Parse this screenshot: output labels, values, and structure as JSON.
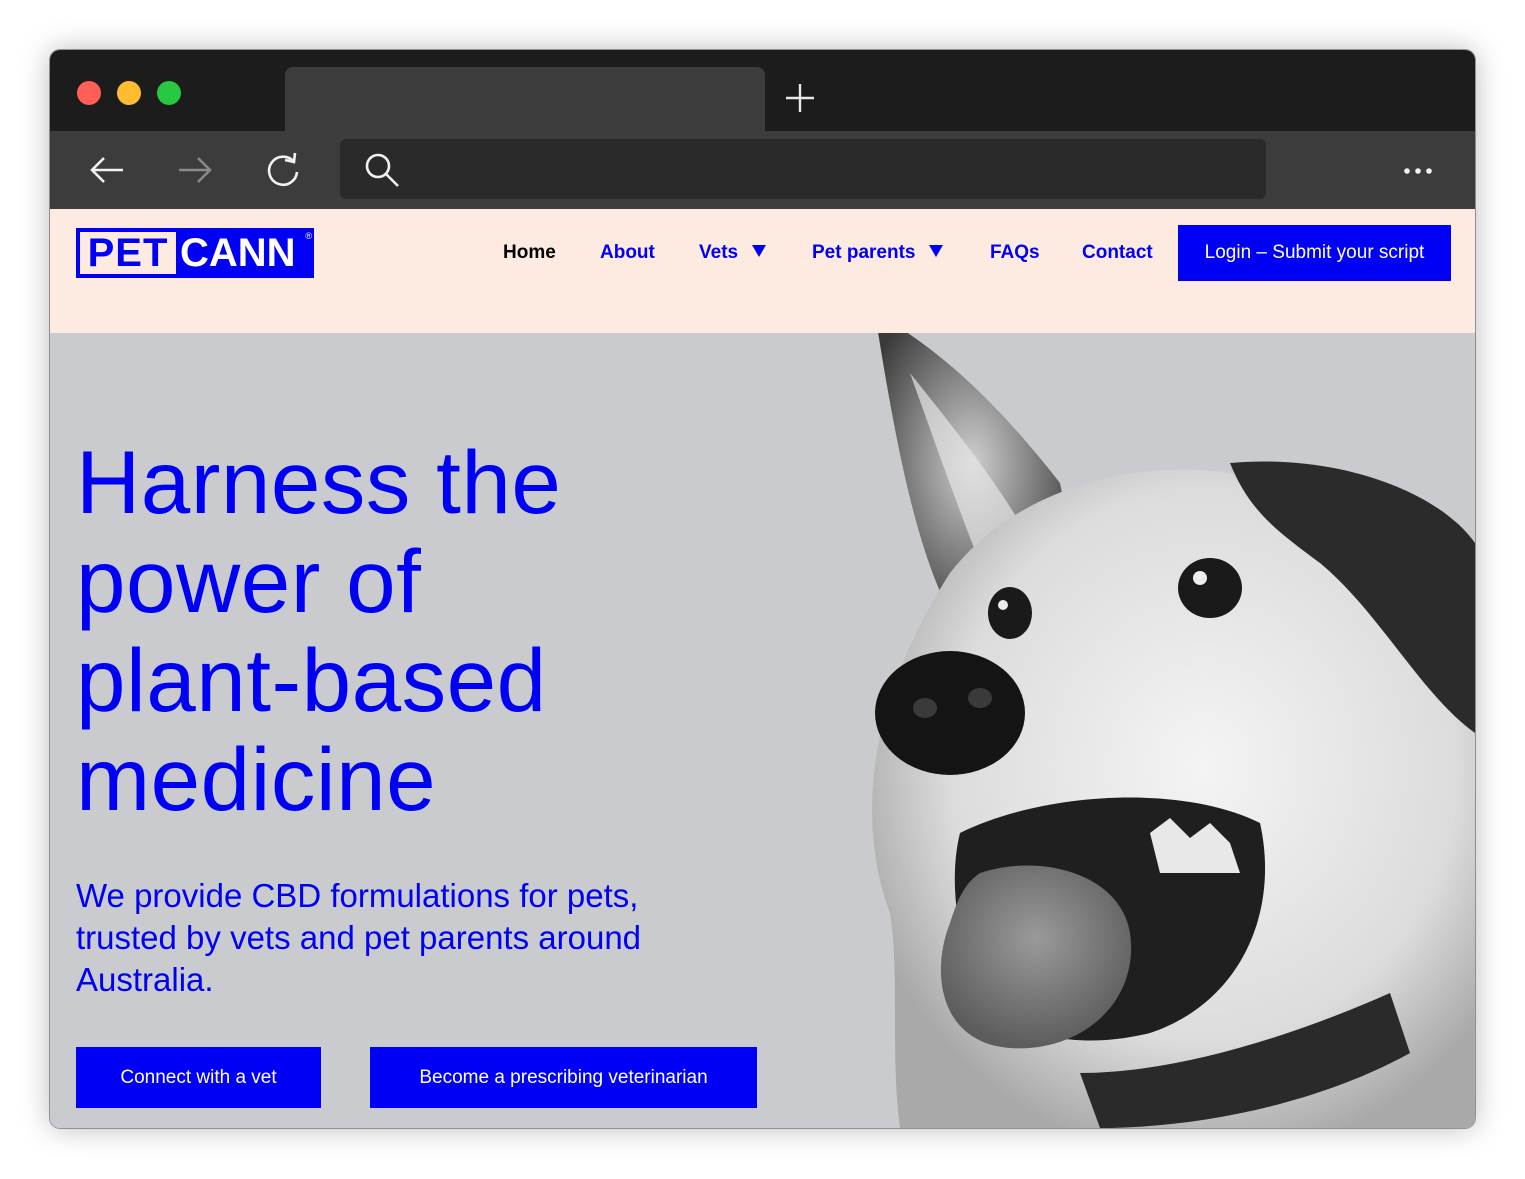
{
  "browser": {
    "traffic_lights": {
      "close": "#ff5f57",
      "minimize": "#febc2e",
      "maximize": "#28c840"
    },
    "tab": {
      "title": ""
    },
    "address_bar": {
      "value": "",
      "placeholder": ""
    },
    "icons": [
      "back-arrow-icon",
      "forward-arrow-icon",
      "reload-icon",
      "search-icon",
      "plus-icon",
      "more-dots-icon"
    ]
  },
  "site": {
    "logo": {
      "part1": "PET",
      "part2": "CANN",
      "registered": "®"
    },
    "nav": {
      "home": "Home",
      "about": "About",
      "vets": "Vets",
      "pet_parents": "Pet parents",
      "faqs": "FAQs",
      "contact": "Contact"
    },
    "login_button": "Login – Submit your script"
  },
  "hero": {
    "title_lines": [
      "Harness the",
      "power of",
      "plant-based",
      "medicine"
    ],
    "subtitle_lines": [
      "We provide CBD formulations for pets,",
      "trusted by vets and pet parents around",
      "Australia."
    ],
    "cta_primary": "Connect with a vet",
    "cta_secondary": "Become a prescribing veterinarian"
  },
  "colors": {
    "brand_blue": "#0000f5",
    "header_bg": "#fdebe1",
    "hero_bg": "#c9cbce",
    "chrome_dark": "#1c1c1c",
    "chrome_toolbar": "#3c3c3c"
  }
}
